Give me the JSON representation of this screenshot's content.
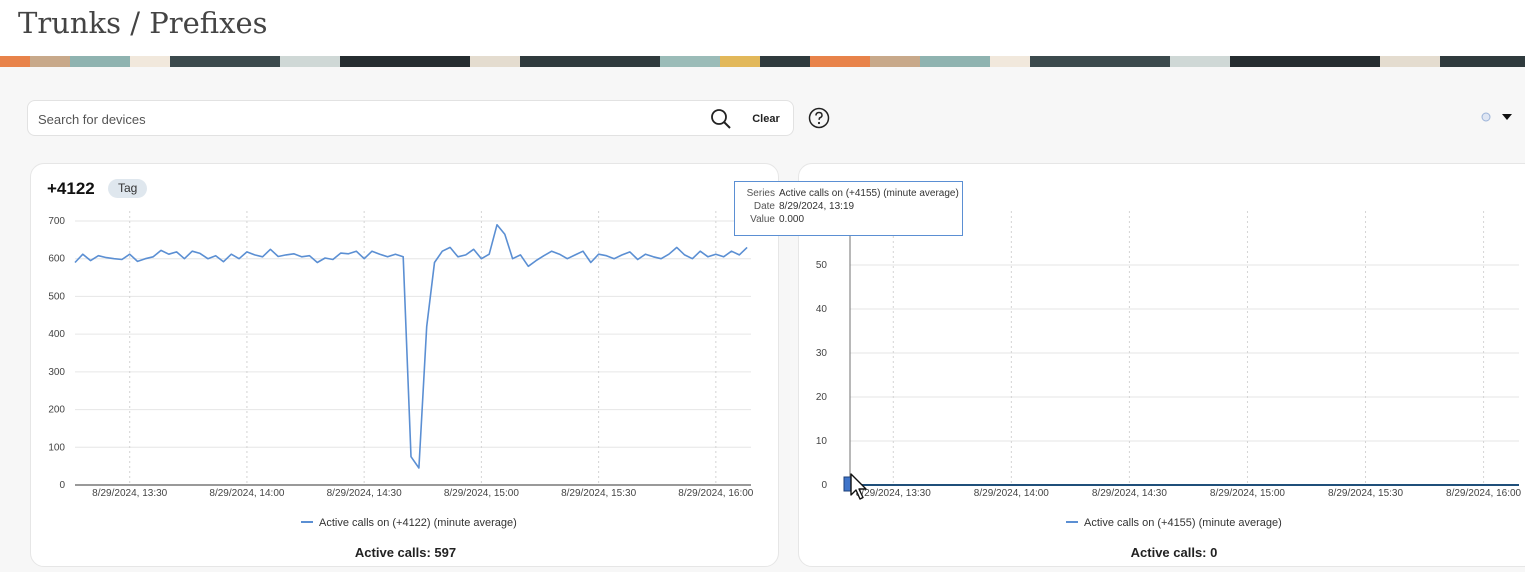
{
  "page": {
    "title": "Trunks / Prefixes"
  },
  "search": {
    "placeholder": "Search for devices",
    "value": "",
    "clear_label": "Clear"
  },
  "icons": {
    "search": "search-icon",
    "help": "help-icon",
    "status": "status-dot-icon",
    "dropdown": "chevron-down-icon",
    "cursor": "mouse-pointer-icon"
  },
  "colors": {
    "series": "#5b8fd3",
    "badge": "#dfe7ee"
  },
  "cards": [
    {
      "title": "+4122",
      "tag": "Tag",
      "legend": "Active calls on (+4122) (minute average)",
      "footer": "Active calls: 597"
    },
    {
      "title": "",
      "tag": "",
      "legend": "Active calls on (+4155) (minute average)",
      "footer": "Active calls: 0"
    }
  ],
  "tooltip": {
    "series_key": "Series",
    "series_value": "Active calls on (+4155) (minute average)",
    "date_key": "Date",
    "date_value": "8/29/2024, 13:19",
    "value_key": "Value",
    "value_value": "0.000"
  },
  "chart_data": [
    {
      "type": "line",
      "series": [
        {
          "name": "Active calls on (+4122) (minute average)"
        }
      ],
      "x_tick_labels": [
        "8/29/2024, 13:30",
        "8/29/2024, 14:00",
        "8/29/2024, 14:30",
        "8/29/2024, 15:00",
        "8/29/2024, 15:30",
        "8/29/2024, 16:00"
      ],
      "y_ticks": [
        0,
        100,
        200,
        300,
        400,
        500,
        600,
        700
      ],
      "ylim": [
        0,
        700
      ],
      "xlim": [
        "8/29/2024, 13:16",
        "8/29/2024, 16:09"
      ],
      "x": [
        "13:16",
        "13:18",
        "13:20",
        "13:22",
        "13:24",
        "13:26",
        "13:28",
        "13:30",
        "13:32",
        "13:34",
        "13:36",
        "13:38",
        "13:40",
        "13:42",
        "13:44",
        "13:46",
        "13:48",
        "13:50",
        "13:52",
        "13:54",
        "13:56",
        "13:58",
        "14:00",
        "14:02",
        "14:04",
        "14:06",
        "14:08",
        "14:10",
        "14:12",
        "14:14",
        "14:16",
        "14:18",
        "14:20",
        "14:22",
        "14:24",
        "14:26",
        "14:28",
        "14:30",
        "14:32",
        "14:34",
        "14:36",
        "14:38",
        "14:40",
        "14:42",
        "14:44",
        "14:46",
        "14:48",
        "14:50",
        "14:52",
        "14:54",
        "14:56",
        "14:58",
        "15:00",
        "15:02",
        "15:04",
        "15:06",
        "15:08",
        "15:10",
        "15:12",
        "15:14",
        "15:16",
        "15:18",
        "15:20",
        "15:22",
        "15:24",
        "15:26",
        "15:28",
        "15:30",
        "15:32",
        "15:34",
        "15:36",
        "15:38",
        "15:40",
        "15:42",
        "15:44",
        "15:46",
        "15:48",
        "15:50",
        "15:52",
        "15:54",
        "15:56",
        "15:58",
        "16:00",
        "16:02",
        "16:04",
        "16:06",
        "16:08"
      ],
      "values": [
        590,
        612,
        595,
        608,
        603,
        600,
        598,
        612,
        593,
        600,
        605,
        622,
        612,
        618,
        600,
        620,
        614,
        600,
        608,
        592,
        612,
        600,
        618,
        610,
        605,
        625,
        606,
        610,
        613,
        605,
        608,
        590,
        602,
        598,
        615,
        613,
        620,
        600,
        620,
        612,
        605,
        612,
        605,
        75,
        45,
        420,
        590,
        620,
        630,
        605,
        610,
        625,
        600,
        612,
        690,
        665,
        600,
        610,
        580,
        595,
        608,
        620,
        612,
        600,
        610,
        620,
        590,
        612,
        608,
        600,
        610,
        618,
        598,
        612,
        605,
        600,
        612,
        630,
        610,
        600,
        620,
        605,
        612,
        605,
        620,
        610,
        630
      ],
      "grid": true,
      "legend": "bottom-center"
    },
    {
      "type": "line",
      "series": [
        {
          "name": "Active calls on (+4155) (minute average)"
        }
      ],
      "x_tick_labels": [
        "8/29/2024, 13:30",
        "8/29/2024, 14:00",
        "8/29/2024, 14:30",
        "8/29/2024, 15:00",
        "8/29/2024, 15:30",
        "8/29/2024, 16:00"
      ],
      "y_ticks": [
        0,
        10,
        20,
        30,
        40,
        50
      ],
      "ylim": [
        0,
        60
      ],
      "xlim": [
        "8/29/2024, 13:19",
        "8/29/2024, 16:09"
      ],
      "x": [
        "13:19",
        "16:09"
      ],
      "values": [
        0,
        0
      ],
      "grid": true,
      "legend": "bottom-center"
    }
  ]
}
